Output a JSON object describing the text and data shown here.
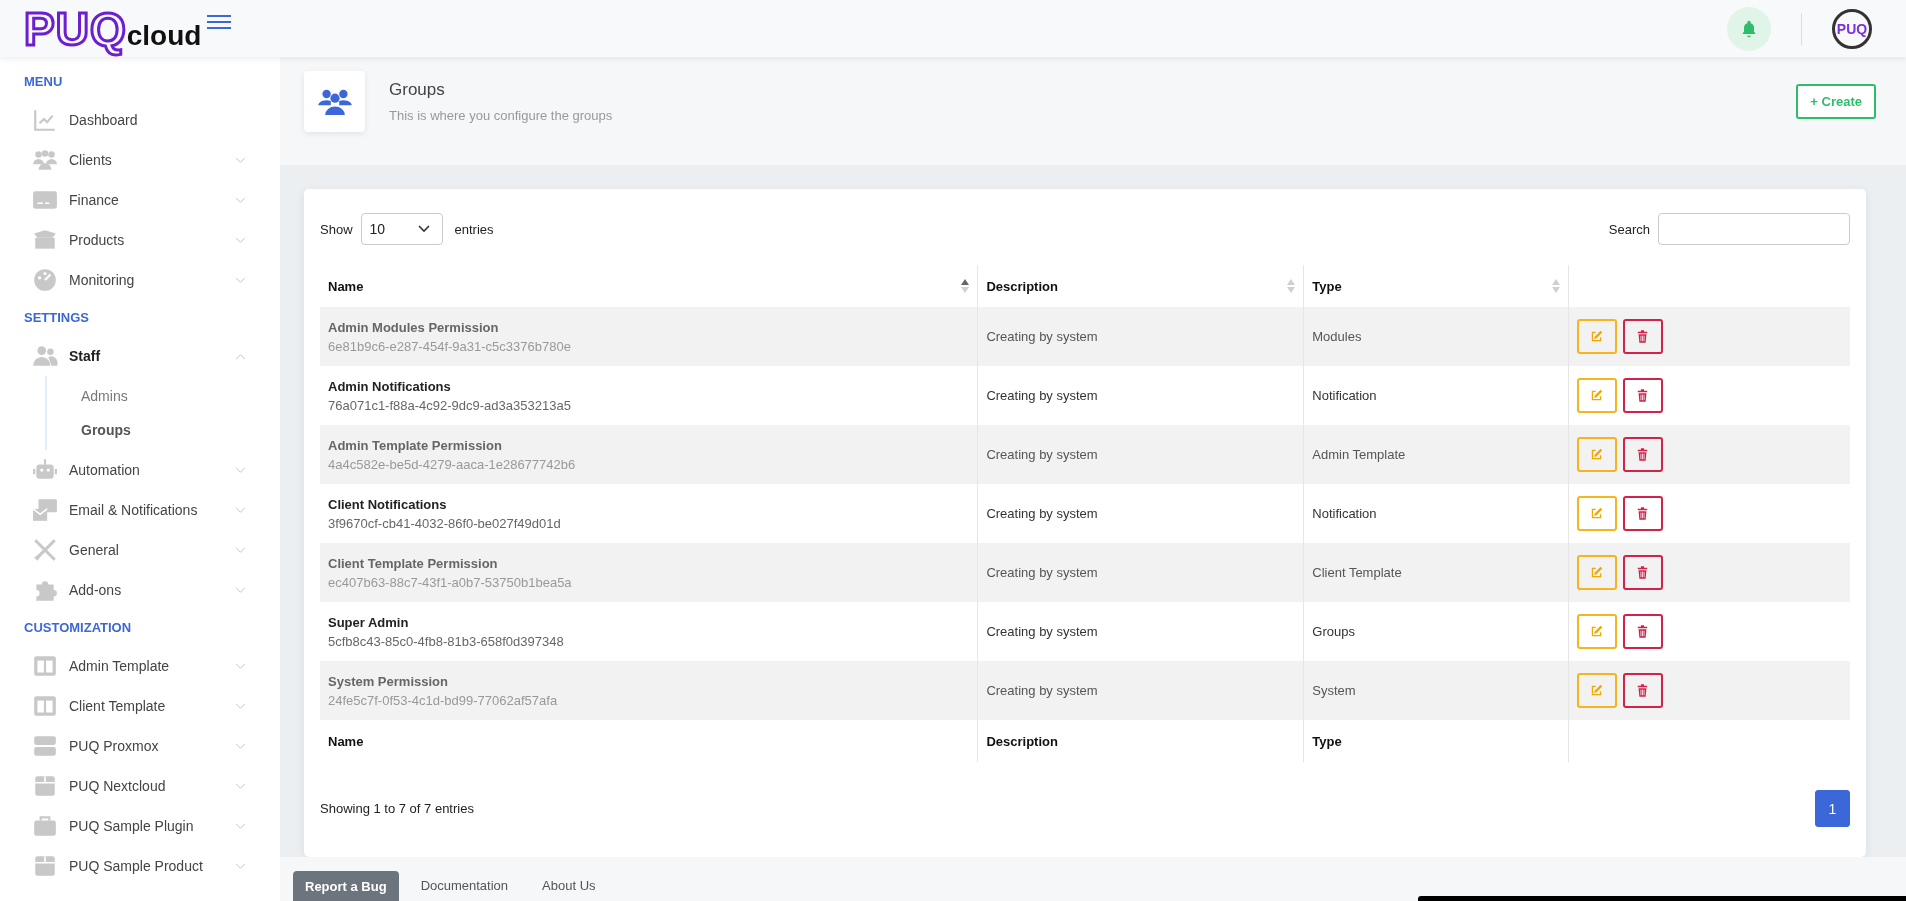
{
  "header": {
    "logo": {
      "brand": "PUQ",
      "suffix": "cloud"
    },
    "avatar": "PUQ"
  },
  "sidebar": {
    "sections": [
      {
        "title": "MENU",
        "items": [
          {
            "label": "Dashboard",
            "kind": "link",
            "expanded": false
          },
          {
            "label": "Clients",
            "kind": "group",
            "expanded": false
          },
          {
            "label": "Finance",
            "kind": "group",
            "expanded": false
          },
          {
            "label": "Products",
            "kind": "group",
            "expanded": false
          },
          {
            "label": "Monitoring",
            "kind": "group",
            "expanded": false
          }
        ]
      },
      {
        "title": "SETTINGS",
        "items": [
          {
            "label": "Staff",
            "kind": "group",
            "expanded": true,
            "children": [
              {
                "label": "Admins",
                "selected": false
              },
              {
                "label": "Groups",
                "selected": true
              }
            ]
          },
          {
            "label": "Automation",
            "kind": "group",
            "expanded": false
          },
          {
            "label": "Email & Notifications",
            "kind": "group",
            "expanded": false
          },
          {
            "label": "General",
            "kind": "group",
            "expanded": false
          },
          {
            "label": "Add-ons",
            "kind": "group",
            "expanded": false
          }
        ]
      },
      {
        "title": "CUSTOMIZATION",
        "items": [
          {
            "label": "Admin Template",
            "kind": "group",
            "expanded": false
          },
          {
            "label": "Client Template",
            "kind": "group",
            "expanded": false
          },
          {
            "label": "PUQ Proxmox",
            "kind": "group",
            "expanded": false
          },
          {
            "label": "PUQ Nextcloud",
            "kind": "group",
            "expanded": false
          },
          {
            "label": "PUQ Sample Plugin",
            "kind": "group",
            "expanded": false
          },
          {
            "label": "PUQ Sample Product",
            "kind": "group",
            "expanded": false
          }
        ]
      }
    ]
  },
  "page": {
    "title": "Groups",
    "subtitle": "This is where you configure the groups",
    "create_button": "+ Create"
  },
  "table": {
    "length_label": "Show",
    "length_value": "10",
    "entries_label": "entries",
    "search_label": "Search",
    "columns": [
      {
        "label": "Name",
        "sorted": true
      },
      {
        "label": "Description",
        "sorted": false
      },
      {
        "label": "Type",
        "sorted": false
      }
    ],
    "rows": [
      {
        "name": "Admin Modules Permission",
        "uuid": "6e81b9c6-e287-454f-9a31-c5c3376b780e",
        "description": "Creating by system",
        "type": "Modules"
      },
      {
        "name": "Admin Notifications",
        "uuid": "76a071c1-f88a-4c92-9dc9-ad3a353213a5",
        "description": "Creating by system",
        "type": "Notification"
      },
      {
        "name": "Admin Template Permission",
        "uuid": "4a4c582e-be5d-4279-aaca-1e28677742b6",
        "description": "Creating by system",
        "type": "Admin Template"
      },
      {
        "name": "Client Notifications",
        "uuid": "3f9670cf-cb41-4032-86f0-be027f49d01d",
        "description": "Creating by system",
        "type": "Notification"
      },
      {
        "name": "Client Template Permission",
        "uuid": "ec407b63-88c7-43f1-a0b7-53750b1bea5a",
        "description": "Creating by system",
        "type": "Client Template"
      },
      {
        "name": "Super Admin",
        "uuid": "5cfb8c43-85c0-4fb8-81b3-658f0d397348",
        "description": "Creating by system",
        "type": "Groups"
      },
      {
        "name": "System Permission",
        "uuid": "24fe5c7f-0f53-4c1d-bd99-77062af57afa",
        "description": "Creating by system",
        "type": "System"
      }
    ],
    "footer_columns": [
      "Name",
      "Description",
      "Type"
    ],
    "info": "Showing 1 to 7 of 7 entries",
    "pages": [
      {
        "label": "1",
        "selected": true
      }
    ]
  },
  "footer": {
    "links": [
      {
        "label": "Report a Bug",
        "kind": "button"
      },
      {
        "label": "Documentation",
        "kind": "link"
      },
      {
        "label": "About Us",
        "kind": "link"
      }
    ]
  }
}
